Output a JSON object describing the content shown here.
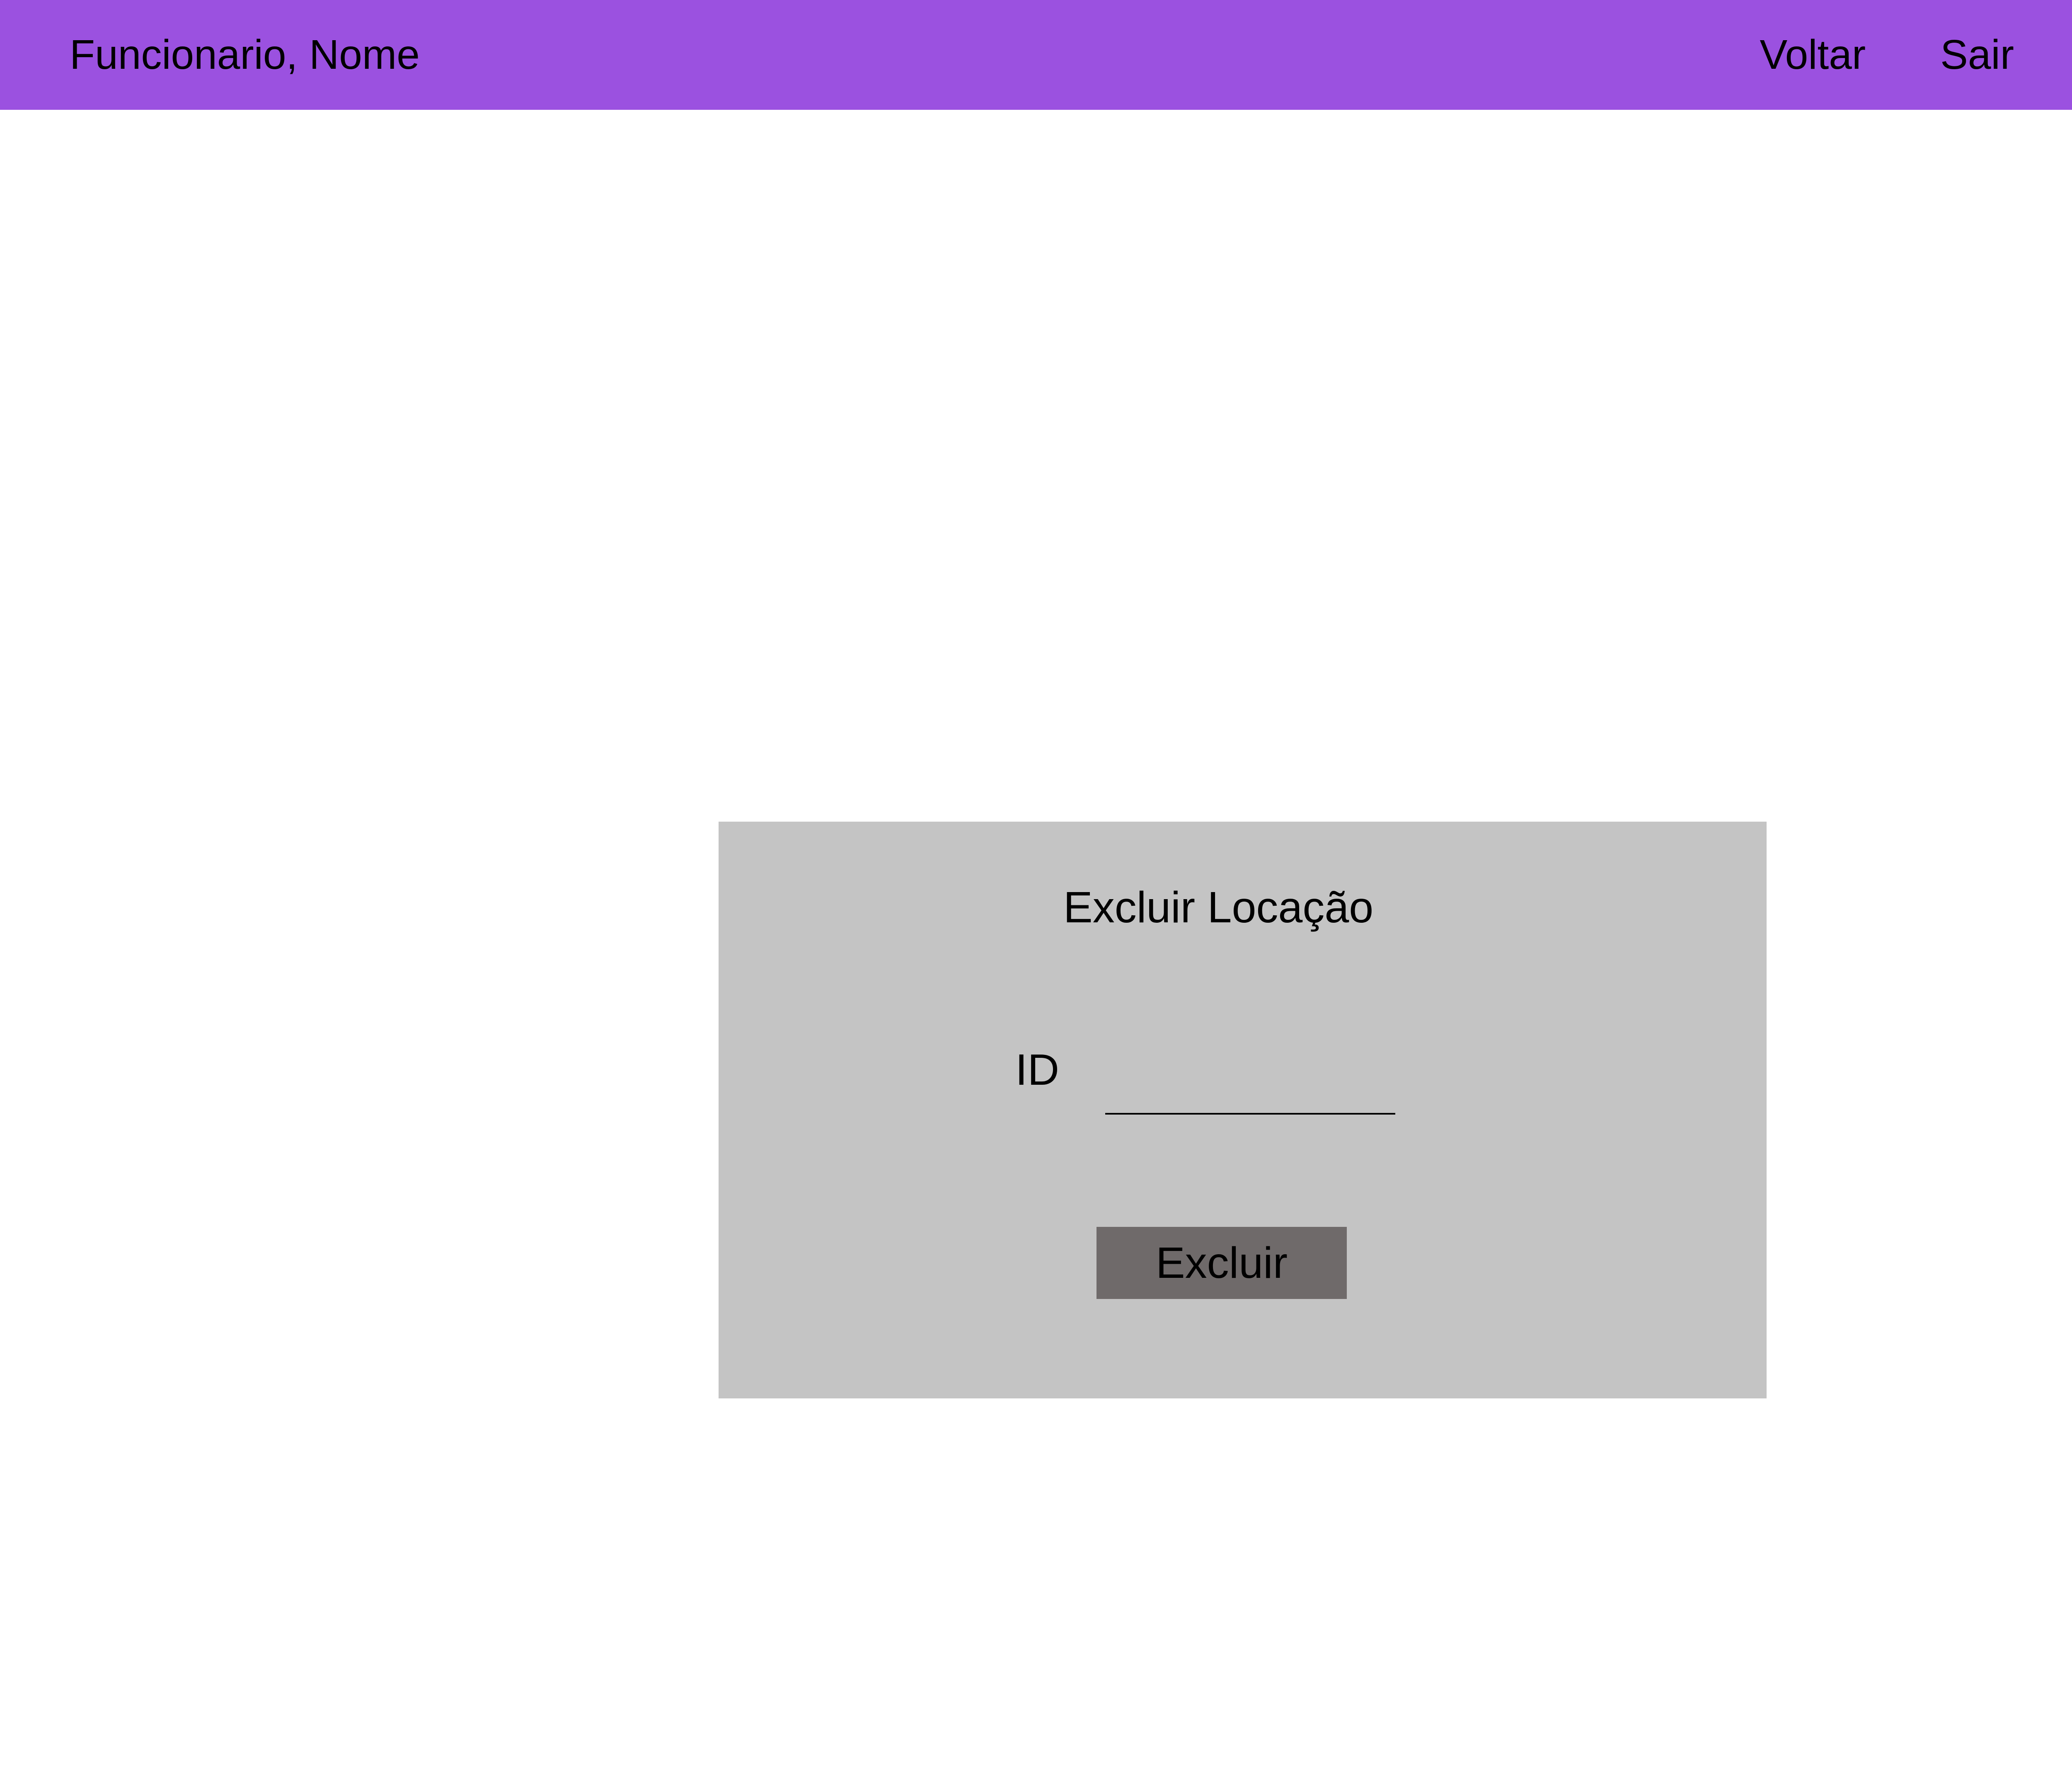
{
  "header": {
    "user_label": "Funcionario, Nome",
    "back_label": "Voltar",
    "logout_label": "Sair"
  },
  "form": {
    "title": "Excluir Locação",
    "id_label": "ID",
    "id_value": "",
    "submit_label": "Excluir"
  },
  "colors": {
    "header_bg": "#9b51e0",
    "card_bg": "#c4c4c4",
    "button_bg": "#6f6a6a"
  }
}
